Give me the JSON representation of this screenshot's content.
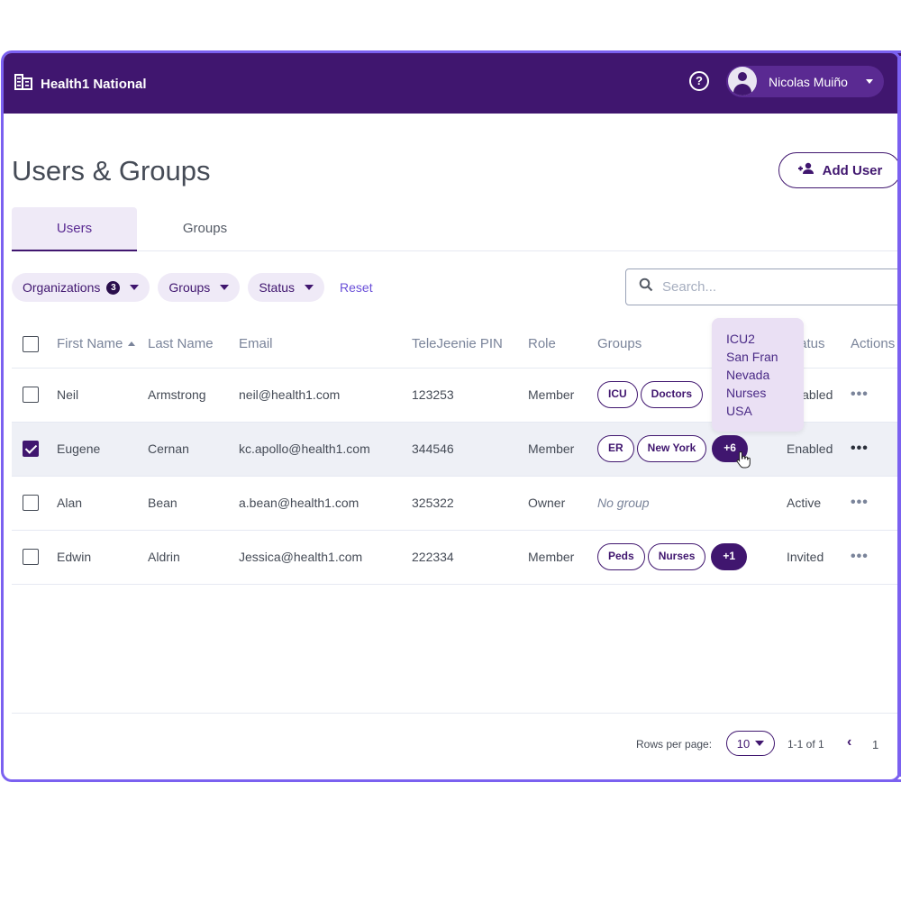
{
  "app": {
    "org_name": "Health1 National",
    "user_name": "Nicolas Muiño",
    "icons": {
      "org": "building-icon",
      "help": "help-circle-icon",
      "avatar": "account-circle-icon",
      "menu": "caret-down-icon"
    }
  },
  "page": {
    "title": "Users & Groups",
    "add_user_label": "Add User",
    "add_user_icon": "person-add-icon"
  },
  "tabs": [
    {
      "label": "Users",
      "active": true
    },
    {
      "label": "Groups",
      "active": false
    }
  ],
  "filters": {
    "organizations": {
      "label": "Organizations",
      "count": "3"
    },
    "groups": {
      "label": "Groups"
    },
    "status": {
      "label": "Status"
    },
    "reset_label": "Reset",
    "search_placeholder": "Search...",
    "search_value": ""
  },
  "table": {
    "columns": [
      "First Name",
      "Last Name",
      "Email",
      "TeleJeenie PIN",
      "Role",
      "Groups",
      "Status",
      "Actions"
    ],
    "sort": {
      "column": "First Name",
      "direction": "ascending"
    },
    "rows": [
      {
        "selected": false,
        "first": "Neil",
        "last": "Armstrong",
        "email": "neil@health1.com",
        "pin": "123253",
        "role": "Member",
        "groups": [
          "ICU",
          "Doctors"
        ],
        "more": "",
        "status": "Enabled",
        "actions": "•••"
      },
      {
        "selected": true,
        "first": "Eugene",
        "last": "Cernan",
        "email": "kc.apollo@health1.com",
        "pin": "344546",
        "role": "Member",
        "groups": [
          "ER",
          "New York"
        ],
        "more": "+6",
        "status": "Enabled",
        "actions": "•••"
      },
      {
        "selected": false,
        "first": "Alan",
        "last": "Bean",
        "email": "a.bean@health1.com",
        "pin": "325322",
        "role": "Owner",
        "groups": [],
        "no_group": "No group",
        "more": "",
        "status": "Active",
        "actions": "•••"
      },
      {
        "selected": false,
        "first": "Edwin",
        "last": "Aldrin",
        "email": "Jessica@health1.com",
        "pin": "222334",
        "role": "Member",
        "groups": [
          "Peds",
          "Nurses"
        ],
        "more": "+1",
        "status": "Invited",
        "actions": "•••"
      }
    ]
  },
  "tooltip": {
    "items": [
      "ICU2",
      "San Fran",
      "Nevada",
      "Nurses",
      "USA"
    ]
  },
  "pagination": {
    "rows_per_page_label": "Rows per page:",
    "rows_per_page_value": "10",
    "range": "1-1 of 1",
    "prev_icon": "chevron-left-icon",
    "page": "1"
  },
  "colors": {
    "brand": "#40166f",
    "accent": "#7b61f0",
    "chip_bg": "#efeaf7",
    "tooltip_bg": "#eae0f4"
  }
}
